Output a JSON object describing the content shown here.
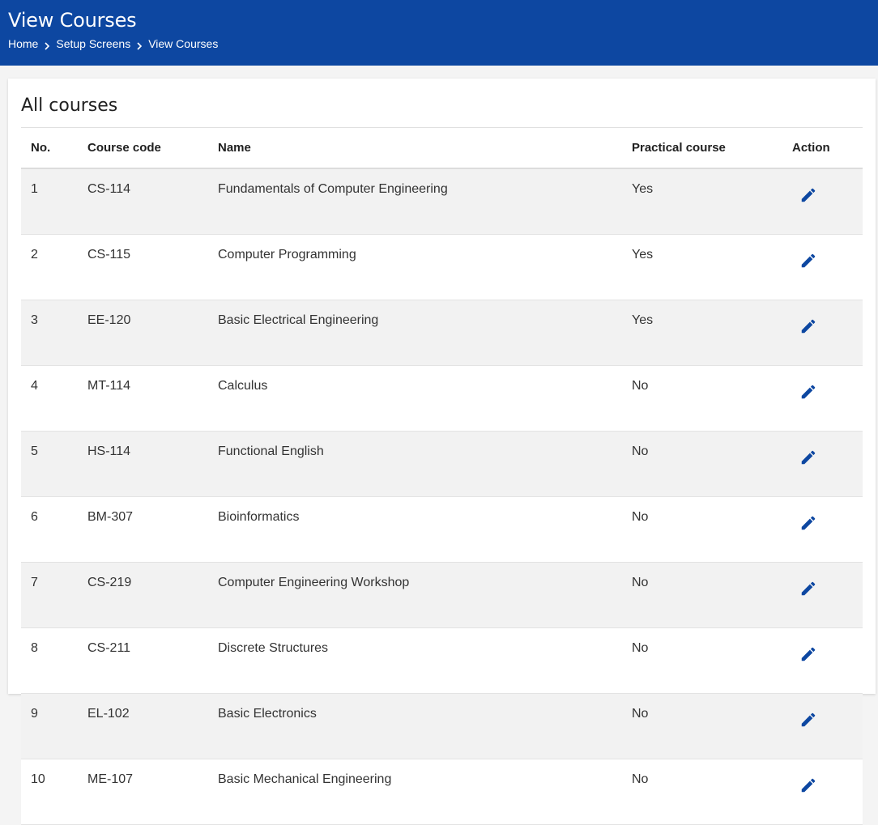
{
  "header": {
    "title": "View Courses",
    "breadcrumb": [
      {
        "label": "Home"
      },
      {
        "label": "Setup Screens"
      },
      {
        "label": "View Courses"
      }
    ],
    "icons": {
      "separator": "chevron-right-icon"
    }
  },
  "colors": {
    "header_bg": "#0d47a1",
    "accent": "#0d47a1"
  },
  "card": {
    "title": "All courses"
  },
  "table": {
    "columns": [
      "No.",
      "Course code",
      "Name",
      "Practical course",
      "Action"
    ],
    "action_icon": "edit-pencil-icon",
    "rows": [
      {
        "no": "1",
        "code": "CS-114",
        "name": "Fundamentals of Computer Engineering",
        "practical": "Yes"
      },
      {
        "no": "2",
        "code": "CS-115",
        "name": "Computer Programming",
        "practical": "Yes"
      },
      {
        "no": "3",
        "code": "EE-120",
        "name": "Basic Electrical Engineering",
        "practical": "Yes"
      },
      {
        "no": "4",
        "code": "MT-114",
        "name": "Calculus",
        "practical": "No"
      },
      {
        "no": "5",
        "code": "HS-114",
        "name": "Functional English",
        "practical": "No"
      },
      {
        "no": "6",
        "code": "BM-307",
        "name": "Bioinformatics",
        "practical": "No"
      },
      {
        "no": "7",
        "code": "CS-219",
        "name": "Computer Engineering Workshop",
        "practical": "No"
      },
      {
        "no": "8",
        "code": "CS-211",
        "name": "Discrete Structures",
        "practical": "No"
      },
      {
        "no": "9",
        "code": "EL-102",
        "name": "Basic Electronics",
        "practical": "No"
      },
      {
        "no": "10",
        "code": "ME-107",
        "name": "Basic Mechanical Engineering",
        "practical": "No"
      }
    ]
  }
}
